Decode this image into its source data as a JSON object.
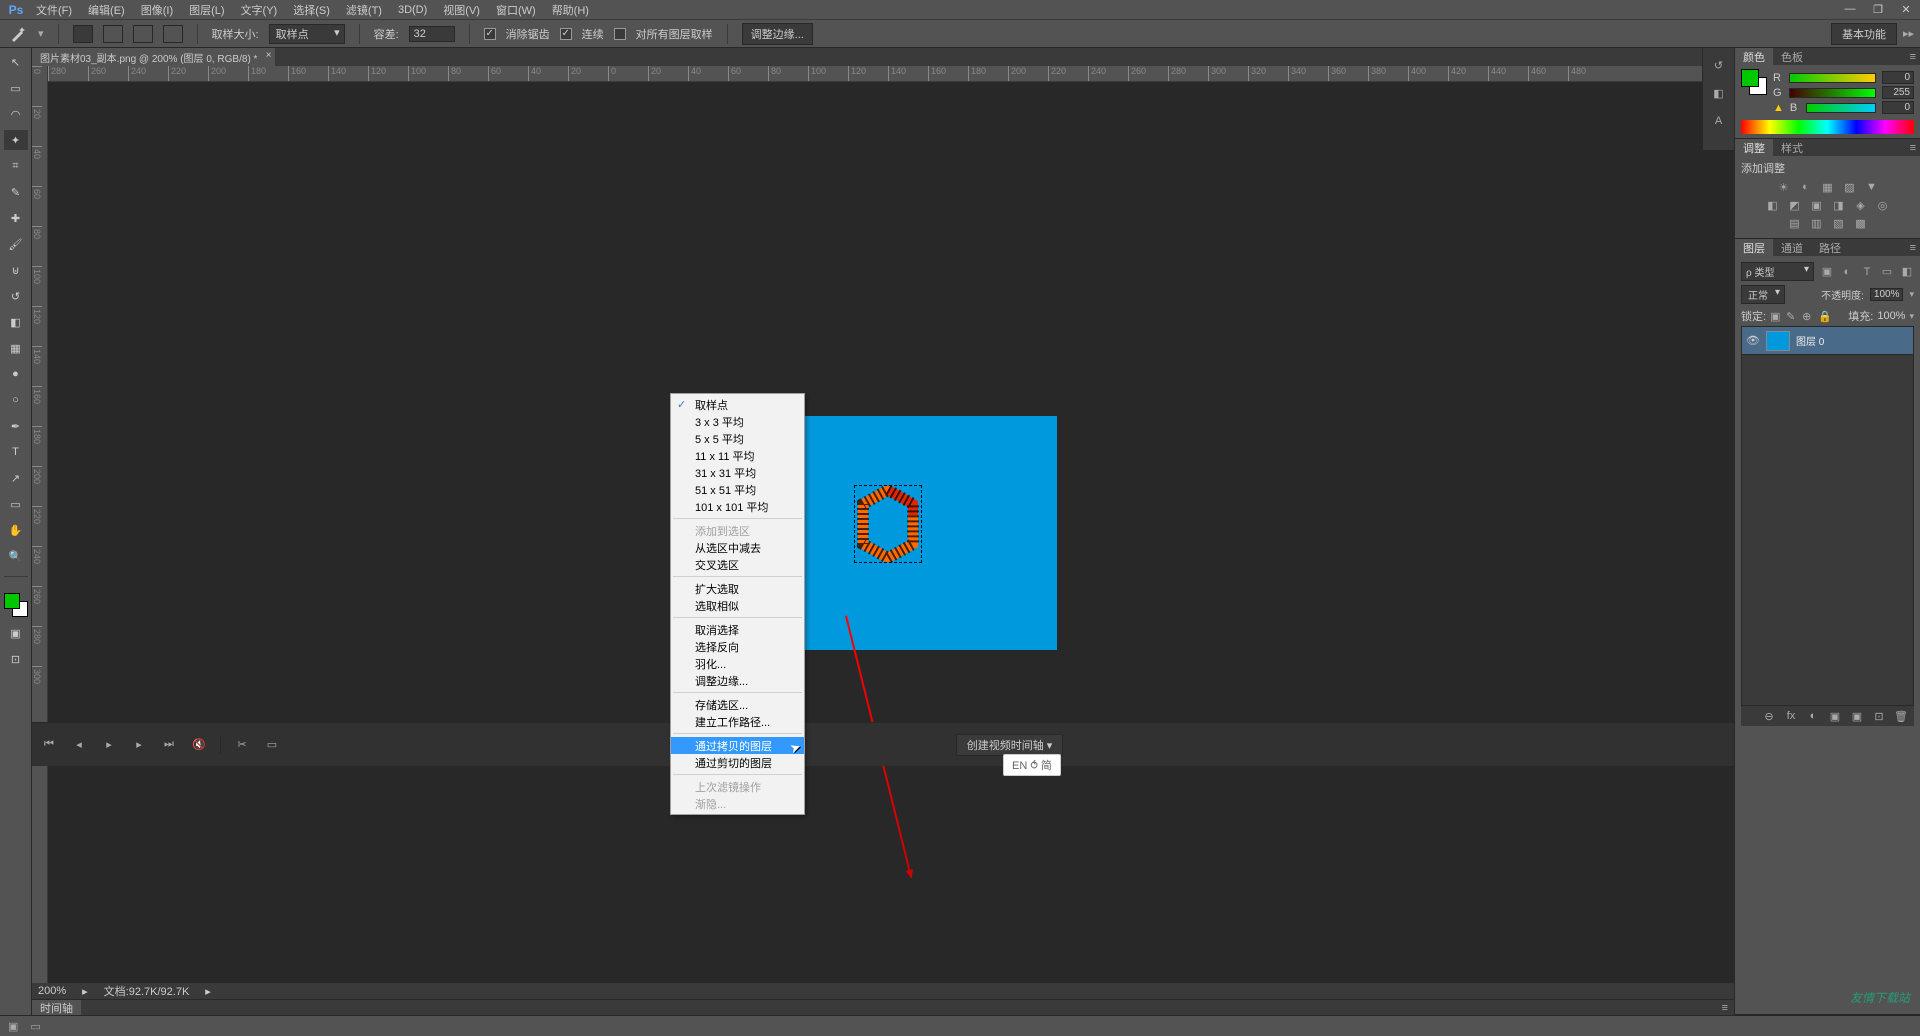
{
  "menubar": {
    "logo": "Ps",
    "items": [
      "文件(F)",
      "编辑(E)",
      "图像(I)",
      "图层(L)",
      "文字(Y)",
      "选择(S)",
      "滤镜(T)",
      "3D(D)",
      "视图(V)",
      "窗口(W)",
      "帮助(H)"
    ]
  },
  "window_controls": {
    "min": "—",
    "max": "❐",
    "close": "✕"
  },
  "optionbar": {
    "sample_size_label": "取样大小:",
    "sample_size_value": "取样点",
    "tolerance_label": "容差:",
    "tolerance_value": "32",
    "anti_alias": "消除锯齿",
    "contiguous": "连续",
    "all_layers": "对所有图层取样",
    "refine_edge": "调整边缘...",
    "basic_button": "基本功能"
  },
  "doc_tab": "图片素材03_副本.png @ 200% (图层 0, RGB/8) *",
  "ruler_h": [
    "280",
    "260",
    "240",
    "220",
    "200",
    "180",
    "160",
    "140",
    "120",
    "100",
    "80",
    "60",
    "40",
    "20",
    "0",
    "20",
    "40",
    "60",
    "80",
    "100",
    "120",
    "140",
    "160",
    "180",
    "200",
    "220",
    "240",
    "260",
    "280",
    "300",
    "320",
    "340",
    "360",
    "380",
    "400",
    "420",
    "440",
    "460",
    "480"
  ],
  "ruler_v": [
    "0",
    "20",
    "40",
    "60",
    "80",
    "100",
    "120",
    "140",
    "160",
    "180",
    "200",
    "220",
    "240",
    "260",
    "280",
    "300"
  ],
  "doc_status": {
    "zoom": "200%",
    "doc_size": "文档:92.7K/92.7K"
  },
  "timeline_tab": "时间轴",
  "timeline_btn": "创建视频时间轴",
  "color_panel": {
    "tabs": [
      "颜色",
      "色板"
    ],
    "r_label": "R",
    "r_val": "0",
    "g_label": "G",
    "g_val": "255",
    "b_label": "B",
    "b_val": "0"
  },
  "adjust_panel": {
    "tabs": [
      "调整",
      "样式"
    ],
    "title": "添加调整",
    "icons1": [
      "☀",
      "◐",
      "▦",
      "▨",
      "▼"
    ],
    "icons2": [
      "◧",
      "◩",
      "▣",
      "◨",
      "◈",
      "◎"
    ],
    "icons3": [
      "▤",
      "▥",
      "▧",
      "▩"
    ]
  },
  "layers_panel": {
    "tabs": [
      "图层",
      "通道",
      "路径"
    ],
    "filter_type": "ρ 类型",
    "filter_icons": [
      "▣",
      "◐",
      "T",
      "▭",
      "◧"
    ],
    "blend_mode": "正常",
    "opacity_label": "不透明度:",
    "opacity_value": "100%",
    "lock_label": "锁定:",
    "lock_icons": [
      "▣",
      "✎",
      "⊕",
      "🔒"
    ],
    "fill_label": "填充:",
    "fill_value": "100%",
    "layer0": "图层 0",
    "footer_icons": [
      "⊖",
      "fx",
      "◐",
      "▣",
      "⊡",
      "🗑"
    ]
  },
  "context_menu": {
    "sample_point": "取样点",
    "avg_3": "3 x 3 平均",
    "avg_5": "5 x 5 平均",
    "avg_11": "11 x 11 平均",
    "avg_31": "31 x 31 平均",
    "avg_51": "51 x 51 平均",
    "avg_101": "101 x 101 平均",
    "add_to": "添加到选区",
    "sub_from": "从选区中减去",
    "intersect": "交叉选区",
    "grow": "扩大选取",
    "similar": "选取相似",
    "deselect": "取消选择",
    "inverse": "选择反向",
    "feather": "羽化...",
    "refine": "调整边缘...",
    "save_sel": "存储选区...",
    "make_path": "建立工作路径...",
    "layer_copy": "通过拷贝的图层",
    "layer_cut": "通过剪切的图层",
    "last_filter": "上次滤镜操作",
    "fade": "渐隐..."
  },
  "ime": "EN ⥀ 简",
  "watermark": "友情下载站"
}
